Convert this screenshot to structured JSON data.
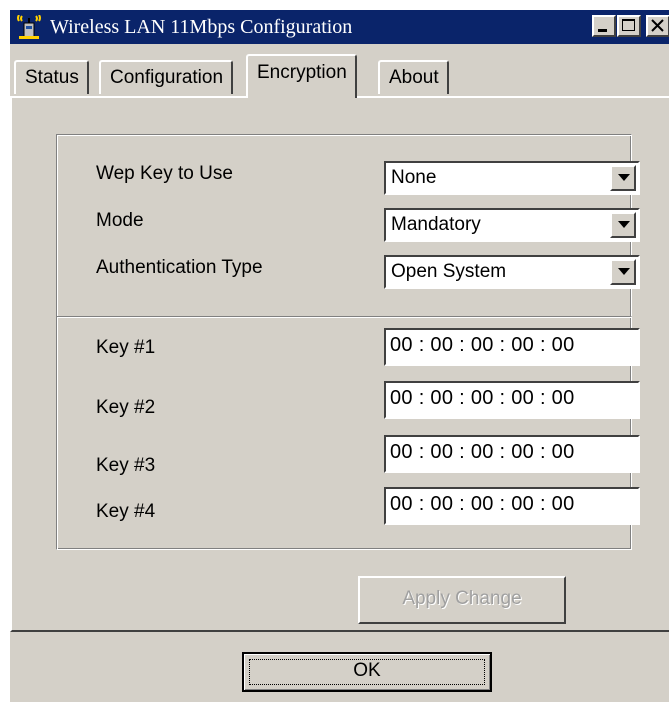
{
  "window": {
    "title": "Wireless LAN 11Mbps Configuration",
    "icon": "wireless-antenna-icon",
    "controls": [
      "minimize-icon",
      "maximize-icon",
      "close-icon"
    ]
  },
  "tabs": [
    {
      "label": "Status",
      "active": false
    },
    {
      "label": "Configuration",
      "active": false
    },
    {
      "label": "Encryption",
      "active": true
    },
    {
      "label": "About",
      "active": false
    }
  ],
  "encryption": {
    "wep_key_label": "Wep Key to Use",
    "wep_key_value": "None",
    "mode_label": "Mode",
    "mode_value": "Mandatory",
    "auth_label": "Authentication Type",
    "auth_value": "Open System",
    "keys": [
      {
        "label": "Key #1",
        "value": "00 : 00 : 00 : 00 : 00"
      },
      {
        "label": "Key #2",
        "value": "00 : 00 : 00 : 00 : 00"
      },
      {
        "label": "Key #3",
        "value": "00 : 00 : 00 : 00 : 00"
      },
      {
        "label": "Key #4",
        "value": "00 : 00 : 00 : 00 : 00"
      }
    ],
    "apply_label": "Apply Change"
  },
  "footer": {
    "ok_label": "OK"
  },
  "colors": {
    "face": "#d4d0c8",
    "titlebar": "#0a246a",
    "disabled_text": "#a0a0a0"
  }
}
